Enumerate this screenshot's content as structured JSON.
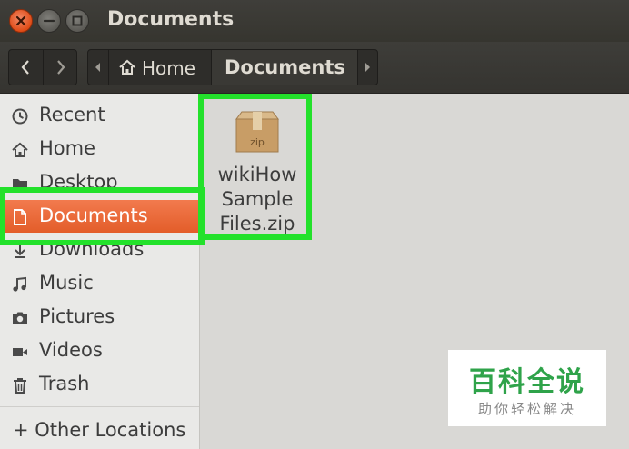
{
  "window": {
    "title": "Documents"
  },
  "nav": {
    "back_icon": "chevron-left-icon",
    "forward_icon": "chevron-right-icon"
  },
  "pathbar": {
    "home_label": "Home",
    "current_label": "Documents"
  },
  "sidebar": {
    "items": [
      {
        "label": "Recent",
        "icon": "clock-icon"
      },
      {
        "label": "Home",
        "icon": "home-icon"
      },
      {
        "label": "Desktop",
        "icon": "folder-icon"
      },
      {
        "label": "Documents",
        "icon": "document-icon"
      },
      {
        "label": "Downloads",
        "icon": "download-icon"
      },
      {
        "label": "Music",
        "icon": "music-icon"
      },
      {
        "label": "Pictures",
        "icon": "camera-icon"
      },
      {
        "label": "Videos",
        "icon": "video-icon"
      },
      {
        "label": "Trash",
        "icon": "trash-icon"
      }
    ],
    "other_locations": "+ Other Locations"
  },
  "files": [
    {
      "name_lines": [
        "wikiHow",
        "Sample",
        "Files.zip"
      ],
      "icon": "zip-archive-icon",
      "icon_label": "zip"
    }
  ],
  "watermark": {
    "title": "百科全说",
    "subtitle": "助你轻松解决"
  },
  "colors": {
    "accent": "#e35d2a",
    "highlight": "#23e12b",
    "titlebar": "#3c3b37"
  }
}
